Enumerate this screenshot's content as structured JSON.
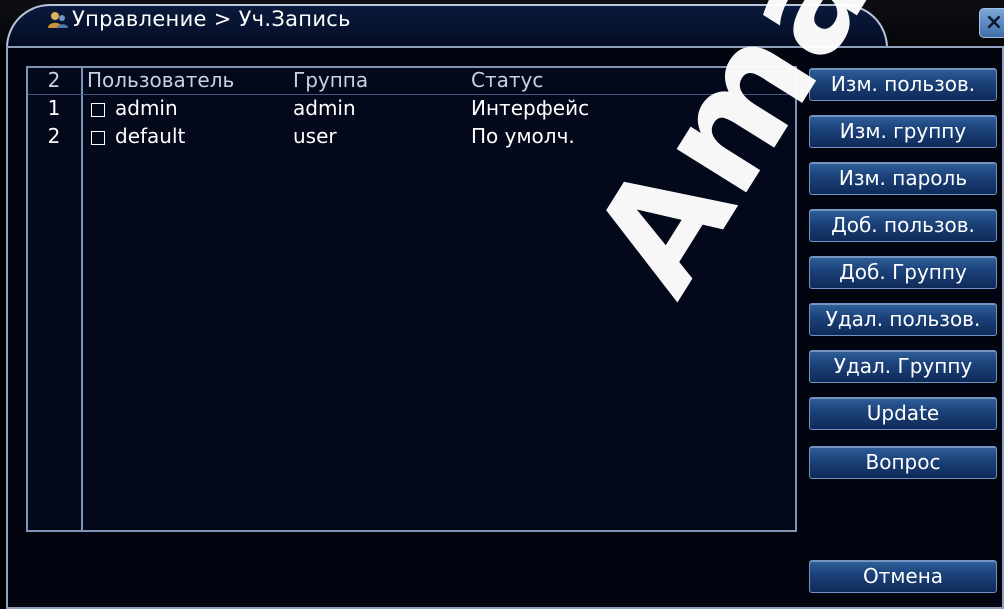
{
  "window": {
    "title": "Управление > Уч.Запись",
    "title_icon": "users-icon",
    "close_label": "×"
  },
  "table": {
    "count": "2",
    "columns": [
      "Пользователь",
      "Группа",
      "Статус"
    ],
    "rows": [
      {
        "num": "1",
        "user": "admin",
        "group": "admin",
        "status": "Интерфейс",
        "checked": false
      },
      {
        "num": "2",
        "user": "default",
        "group": "user",
        "status": "По умолч.",
        "checked": false
      }
    ]
  },
  "buttons": {
    "edit_user": "Изм. пользов.",
    "edit_group": "Изм. группу",
    "change_password": "Изм. пароль",
    "add_user": "Доб. пользов.",
    "add_group": "Доб. Группу",
    "delete_user": "Удал. пользов.",
    "delete_group": "Удал. Группу",
    "update": "Update",
    "help": "Вопрос",
    "cancel": "Отмена"
  },
  "watermark": "Amaxk",
  "colors": {
    "background": "#000000",
    "panel": "#02050f",
    "border": "#8fa0bd",
    "button": "#1b4178",
    "text": "#ffffff"
  }
}
